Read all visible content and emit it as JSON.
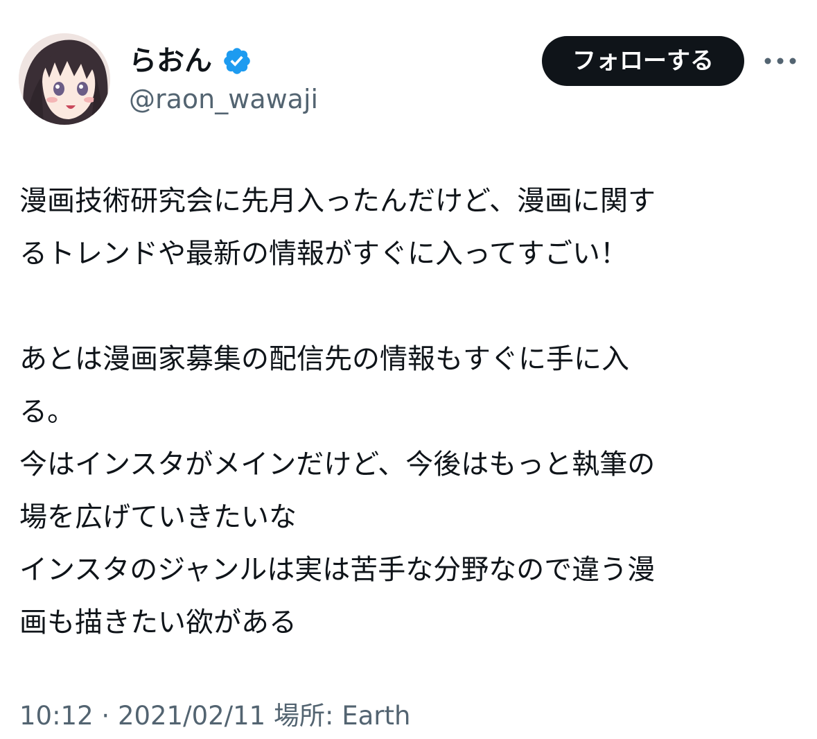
{
  "author": {
    "display_name": "らおん",
    "handle": "@raon_wawaji",
    "verified": true,
    "avatar_icon": "anime-girl-avatar"
  },
  "actions": {
    "follow_label": "フォローする",
    "more_icon": "ellipsis-icon"
  },
  "tweet": {
    "lines": [
      "漫画技術研究会に先月入ったんだけど、漫画に関す",
      "るトレンドや最新の情報がすぐに入ってすごい！",
      "",
      "あとは漫画家募集の配信先の情報もすぐに手に入",
      "る。",
      "今はインスタがメインだけど、今後はもっと執筆の",
      "場を広げていきたいな",
      "インスタのジャンルは実は苦手な分野なので違う漫",
      "画も描きたい欲がある"
    ]
  },
  "meta": {
    "time": "10:12",
    "separator": "·",
    "date": "2021/02/11",
    "location_label": "場所: Earth"
  },
  "colors": {
    "text": "#0f1419",
    "secondary": "#536471",
    "verified": "#1d9bf0",
    "button_bg": "#0f1419"
  }
}
